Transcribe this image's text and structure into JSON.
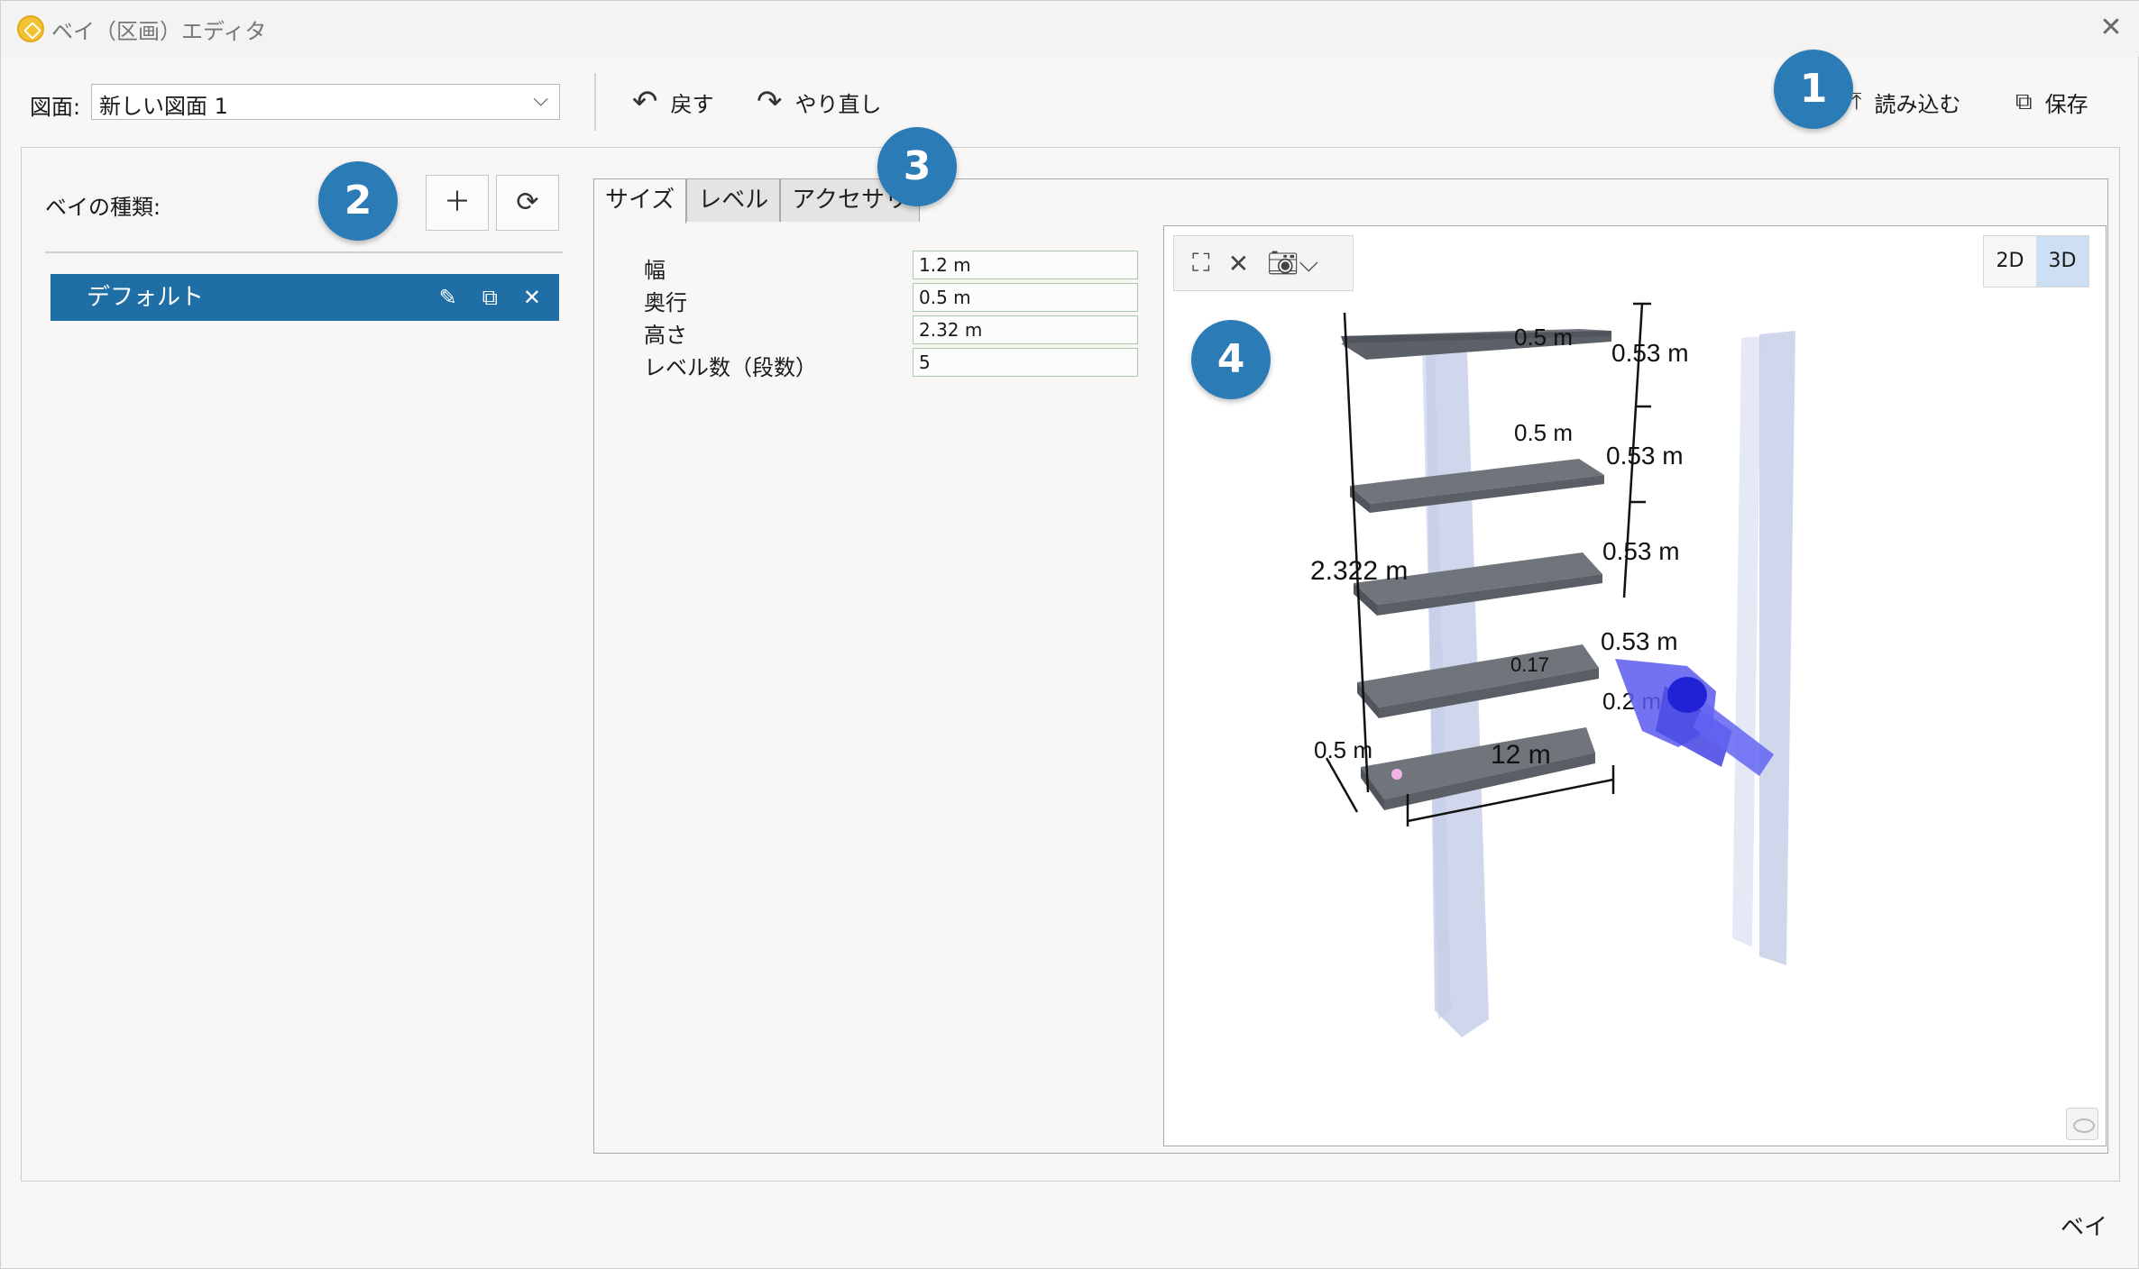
{
  "window": {
    "title": "ベイ（区画）エディタ"
  },
  "toolbar": {
    "drawing_label": "図面:",
    "drawing_value": "新しい図面 1",
    "undo_label": "戻す",
    "redo_label": "やり直し",
    "load_label": "読み込む",
    "save_label": "保存"
  },
  "badges": [
    "1",
    "2",
    "3",
    "4"
  ],
  "left_panel": {
    "bay_types_label": "ベイの種類:",
    "bay_items": [
      {
        "label": "デフォルト"
      }
    ]
  },
  "tabs": [
    {
      "label": "サイズ",
      "active": true
    },
    {
      "label": "レベル",
      "active": false
    },
    {
      "label": "アクセサリ",
      "active": false
    }
  ],
  "properties": [
    {
      "label": "幅",
      "value": "1.2 m"
    },
    {
      "label": "奥行",
      "value": "0.5 m"
    },
    {
      "label": "高さ",
      "value": "2.32 m"
    },
    {
      "label": "レベル数（段数）",
      "value": "5"
    }
  ],
  "viewport": {
    "mode_2d": "2D",
    "mode_3d": "3D",
    "active_mode": "3D",
    "dimensions": {
      "depth_top": "0.5  m",
      "level_1": "0.53  m",
      "depth_2": "0.5  m",
      "level_2": "0.53  m",
      "level_3": "0.53  m",
      "total_height": "2.322  m",
      "level_4": "0.53  m",
      "partial": "0.17",
      "bottom_gap": "0.2  m",
      "depth_bottom": "0.5  m",
      "width": "12  m"
    }
  },
  "footer": {
    "status": "ベイ"
  },
  "colors": {
    "accent": "#1f6fa6",
    "badge": "#2b7bb6",
    "shelf": "#6d7278",
    "upright": "#a9b4dd"
  }
}
